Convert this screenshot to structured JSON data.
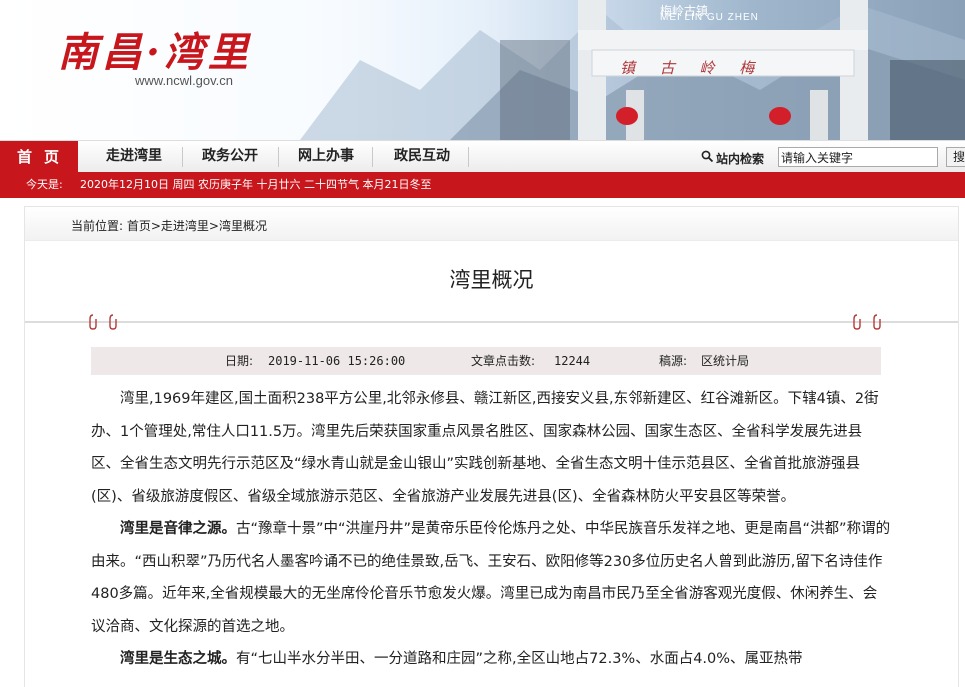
{
  "header": {
    "logo_title": "南昌·湾里",
    "logo_url": "www.ncwl.gov.cn",
    "banner_tag": "梅岭古镇",
    "banner_tag_en": "MEI LIN GU ZHEN",
    "arch_text": "镇 古 岭 梅"
  },
  "nav": {
    "home": "首页",
    "items": [
      "走进湾里",
      "政务公开",
      "网上办事",
      "政民互动"
    ],
    "search_label": "站内检索",
    "search_placeholder": "请输入关键字",
    "search_button": "搜"
  },
  "datebar": {
    "today_label": "今天是:",
    "date_text": "2020年12月10日 周四 农历庚子年 十月廿六 二十四节气 本月21日冬至"
  },
  "breadcrumb": "当前位置: 首页>走进湾里>湾里概况",
  "article": {
    "title": "湾里概况",
    "meta": {
      "date_label": "日期:",
      "date_value": "2019-11-06 15:26:00",
      "clicks_label": "文章点击数:",
      "clicks_value": "12244",
      "source_label": "稿源:",
      "source_value": "区统计局"
    },
    "p1": "湾里,1969年建区,国土面积238平方公里,北邻永修县、赣江新区,西接安义县,东邻新建区、红谷滩新区。下辖4镇、2街办、1个管理处,常住人口11.5万。湾里先后荣获国家重点风景名胜区、国家森林公园、国家生态区、全省科学发展先进县区、全省生态文明先行示范区及“绿水青山就是金山银山”实践创新基地、全省生态文明十佳示范县区、全省首批旅游强县(区)、省级旅游度假区、省级全域旅游示范区、全省旅游产业发展先进县(区)、全省森林防火平安县区等荣誉。",
    "p2_bold": "湾里是音律之源。",
    "p2": "古“豫章十景”中“洪崖丹井”是黄帝乐臣伶伦炼丹之处、中华民族音乐发祥之地、更是南昌“洪都”称谓的由来。“西山积翠”乃历代名人墨客吟诵不已的绝佳景致,岳飞、王安石、欧阳修等230多位历史名人曾到此游历,留下名诗佳作480多篇。近年来,全省规模最大的无坐席伶伦音乐节愈发火爆。湾里已成为南昌市民乃至全省游客观光度假、休闲养生、会议洽商、文化探源的首选之地。",
    "p3_bold": "湾里是生态之城。",
    "p3": "有“七山半水分半田、一分道路和庄园”之称,全区山地占72.3%、水面占4.0%、属亚热带"
  },
  "colors": {
    "brand_red": "#c8161d",
    "meta_bg": "#efe8e8"
  }
}
